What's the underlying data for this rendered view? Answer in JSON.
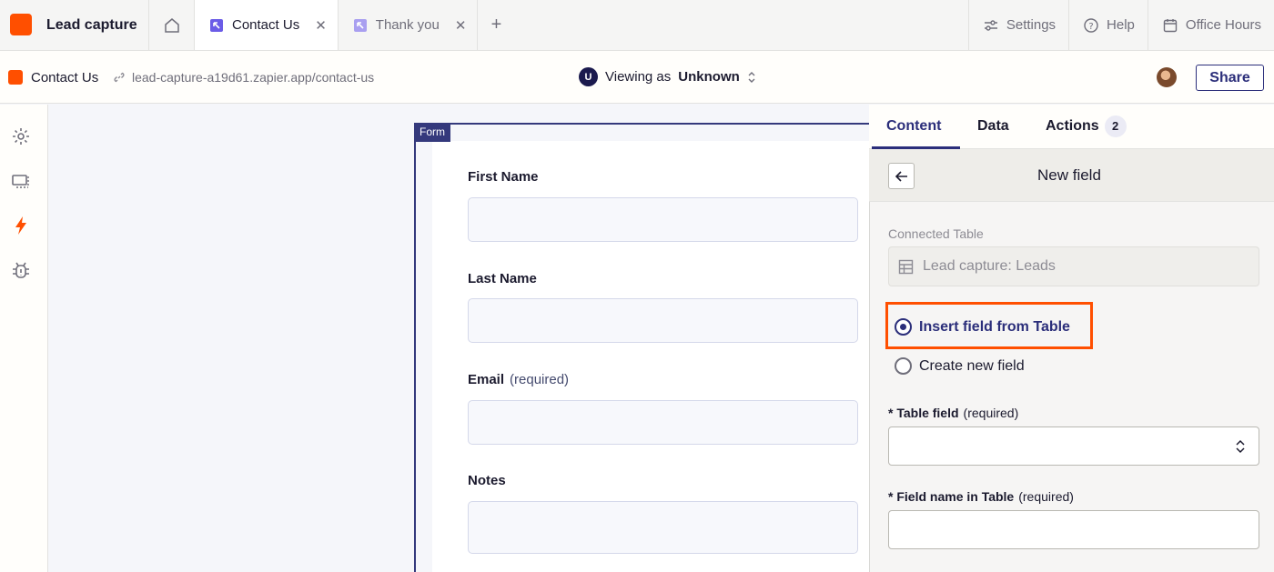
{
  "app": {
    "name": "Lead capture",
    "brand_color": "#ff4f00"
  },
  "tabs": [
    {
      "label": "Contact Us",
      "active": true
    },
    {
      "label": "Thank you",
      "active": false
    }
  ],
  "top_links": {
    "settings": "Settings",
    "help": "Help",
    "office_hours": "Office Hours"
  },
  "page": {
    "name": "Contact Us",
    "url": "lead-capture-a19d61.zapier.app/contact-us",
    "viewing_prefix": "Viewing as",
    "viewing_user": "Unknown",
    "viewing_initial": "U",
    "share_label": "Share"
  },
  "form": {
    "tag": "Form",
    "fields": [
      {
        "label": "First Name",
        "required_text": ""
      },
      {
        "label": "Last Name",
        "required_text": ""
      },
      {
        "label": "Email",
        "required_text": "(required)"
      },
      {
        "label": "Notes",
        "required_text": ""
      }
    ]
  },
  "panel": {
    "tabs": {
      "content": "Content",
      "data": "Data",
      "actions": "Actions",
      "actions_badge": "2"
    },
    "title": "New field",
    "connected_table_label": "Connected Table",
    "connected_table_value": "Lead capture: Leads",
    "options": {
      "insert": "Insert field from Table",
      "create": "Create new field"
    },
    "table_field": {
      "star": "*",
      "label": "Table field",
      "required_text": "(required)"
    },
    "field_name": {
      "star": "*",
      "label": "Field name in Table",
      "required_text": "(required)"
    }
  }
}
